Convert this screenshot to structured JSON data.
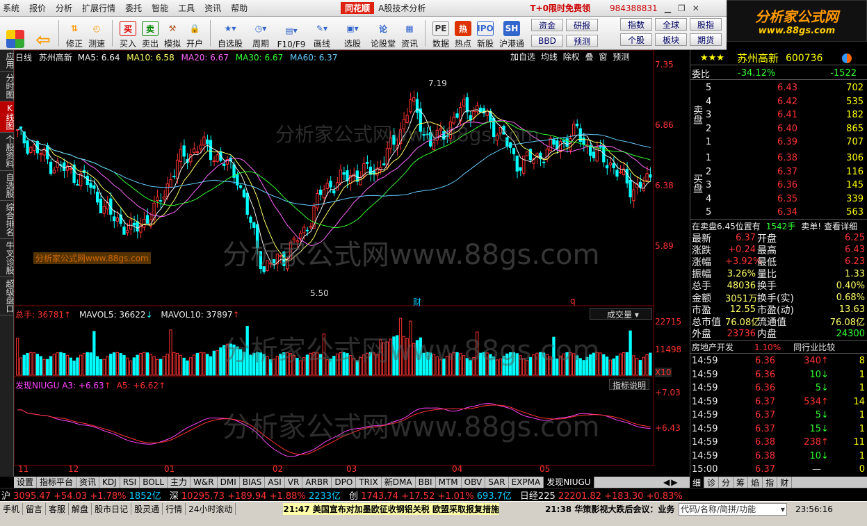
{
  "menu": {
    "items": [
      "系统",
      "报价",
      "分析",
      "扩展行情",
      "委托",
      "智能",
      "工具",
      "资讯",
      "帮助"
    ],
    "brand": "同花顺",
    "title": "A股技术分析",
    "promo": "T+0限时免费领",
    "phone": "984388831"
  },
  "logo": {
    "line1": "分析家公式网",
    "line2": "www.88gs.com"
  },
  "toolbar": {
    "buttons": [
      "修正",
      "测速",
      "买入",
      "卖出",
      "模拟",
      "开户",
      "自选股",
      "周期",
      "F10/F9",
      "画线",
      "选股",
      "论股堂",
      "资讯",
      "数据",
      "热点",
      "新股",
      "沪港通"
    ],
    "text_buttons": [
      "资金",
      "研报",
      "BBD",
      "预测",
      "指数",
      "全球",
      "股指",
      "个股",
      "板块",
      "期货"
    ]
  },
  "sidebar": [
    "应用",
    "分时图",
    "K线图",
    "个股资料",
    "自选股",
    "综合排名",
    "牛叉诊股",
    "超级盘口"
  ],
  "chart": {
    "header": {
      "period": "日线",
      "stock": "苏州高新",
      "ma5": "MA5: 6.64",
      "ma10": "MA10: 6.58",
      "ma20": "MA20: 6.67",
      "ma30": "MA30: 6.67",
      "ma60": "MA60: 6.37"
    },
    "controls": [
      "加自选",
      "均线",
      "除权",
      "叠",
      "窗",
      "预测"
    ],
    "price_axis": [
      "7.35",
      "6.86",
      "6.38",
      "5.89"
    ],
    "high_label": "7.19",
    "low_label": "5.50",
    "markers": [
      "财",
      "q"
    ],
    "watermark": "分析家公式网www.88gs.com",
    "small_watermark": "分析家公式网www.88gs.com",
    "volume": {
      "title": "总手: 36781",
      "mavol5": "MAVOL5: 36622",
      "mavol10": "MAVOL10: 37897",
      "selector": "成交量",
      "axis": [
        "22715",
        "11498"
      ],
      "unit": "X10"
    },
    "indicator": {
      "title": "发现NIUGU",
      "a3": "A3: +6.63",
      "a5": "A5: +6.62",
      "button": "指标说明",
      "axis": [
        "+7.03",
        "+6.43"
      ]
    },
    "months": [
      "11",
      "12",
      "01",
      "02",
      "03",
      "04",
      "05"
    ]
  },
  "chart_data": {
    "type": "line",
    "title": "苏州高新 600736 日线",
    "series": [
      {
        "name": "MA5",
        "last": 6.64
      },
      {
        "name": "MA10",
        "last": 6.58
      },
      {
        "name": "MA20",
        "last": 6.67
      },
      {
        "name": "MA30",
        "last": 6.67
      },
      {
        "name": "MA60",
        "last": 6.37
      }
    ],
    "ylim": [
      5.5,
      7.35
    ],
    "high": 7.19,
    "low": 5.5
  },
  "quote": {
    "stars": "★★★",
    "name": "苏州高新",
    "code": "600736",
    "weibi_label": "委比",
    "weibi": "-34.12%",
    "weicha": "-1522",
    "sell_label": "卖盘",
    "buy_label": "买盘",
    "sells": [
      {
        "lv": "5",
        "p": "6.43",
        "v": "702"
      },
      {
        "lv": "4",
        "p": "6.42",
        "v": "535"
      },
      {
        "lv": "3",
        "p": "6.41",
        "v": "182"
      },
      {
        "lv": "2",
        "p": "6.40",
        "v": "865"
      },
      {
        "lv": "1",
        "p": "6.39",
        "v": "707"
      }
    ],
    "buys": [
      {
        "lv": "1",
        "p": "6.38",
        "v": "306"
      },
      {
        "lv": "2",
        "p": "6.37",
        "v": "116"
      },
      {
        "lv": "3",
        "p": "6.36",
        "v": "145"
      },
      {
        "lv": "4",
        "p": "6.35",
        "v": "339"
      },
      {
        "lv": "5",
        "p": "6.34",
        "v": "563"
      }
    ],
    "notice": "在卖盘6.45位置有",
    "notice_vol": "1542手",
    "notice_tail": "卖单!",
    "detail": "查看详细",
    "stats": [
      {
        "k1": "最新",
        "v1": "6.37",
        "k2": "开盘",
        "v2": "6.25"
      },
      {
        "k1": "涨跌",
        "v1": "+0.24",
        "k2": "最高",
        "v2": "6.43"
      },
      {
        "k1": "涨幅",
        "v1": "+3.92%",
        "k2": "最低",
        "v2": "6.23"
      },
      {
        "k1": "振幅",
        "v1": "3.26%",
        "k2": "量比",
        "v2": "1.33"
      },
      {
        "k1": "总手",
        "v1": "48036",
        "k2": "换手",
        "v2": "0.40%"
      },
      {
        "k1": "金额",
        "v1": "3051万",
        "k2": "换手(实)",
        "v2": "0.68%"
      },
      {
        "k1": "市盈",
        "v1": "12.55",
        "k2": "市盈(动)",
        "v2": "13.63"
      },
      {
        "k1": "总市值",
        "v1": "76.08亿",
        "k2": "流通值",
        "v2": "76.08亿"
      },
      {
        "k1": "外盘",
        "v1": "23736",
        "k2": "内盘",
        "v2": "24300"
      }
    ],
    "sector": "房地产开发",
    "sector_pct": "1.10%",
    "compare": "同行业比较",
    "ticks": [
      {
        "t": "14:59",
        "p": "6.36",
        "v": "340",
        "d": "up",
        "n": "8"
      },
      {
        "t": "14:59",
        "p": "6.36",
        "v": "10",
        "d": "dn",
        "n": "1"
      },
      {
        "t": "14:59",
        "p": "6.36",
        "v": "5",
        "d": "dn",
        "n": "1"
      },
      {
        "t": "14:59",
        "p": "6.37",
        "v": "534",
        "d": "up",
        "n": "14"
      },
      {
        "t": "14:59",
        "p": "6.37",
        "v": "5",
        "d": "dn",
        "n": "1"
      },
      {
        "t": "14:59",
        "p": "6.37",
        "v": "15",
        "d": "dn",
        "n": "1"
      },
      {
        "t": "14:59",
        "p": "6.38",
        "v": "238",
        "d": "up",
        "n": "11"
      },
      {
        "t": "14:59",
        "p": "6.38",
        "v": "10",
        "d": "dn",
        "n": "1"
      },
      {
        "t": "15:00",
        "p": "6.37",
        "v": "—",
        "d": "",
        "n": "0"
      }
    ]
  },
  "bottom_tabs": [
    "设置",
    "指标平台",
    "资讯",
    "KDJ",
    "RSI",
    "BOLL",
    "主力",
    "W&R",
    "DMI",
    "BIAS",
    "ASI",
    "VR",
    "ARBR",
    "DPO",
    "TRIX",
    "新DMA",
    "BBI",
    "MTM",
    "OBV",
    "SAR",
    "EXPMA",
    "发现NIUGU"
  ],
  "right_tabs": [
    "细",
    "诊",
    "分",
    "筹",
    "焰",
    "指",
    "财"
  ],
  "ticker": [
    {
      "label": "沪",
      "v": "3095.47",
      "c": "+54.03",
      "p": "+1.78%",
      "amt": "1852亿"
    },
    {
      "label": "深",
      "v": "10295.73",
      "c": "+189.94",
      "p": "+1.88%",
      "amt": "2233亿"
    },
    {
      "label": "创",
      "v": "1743.74",
      "c": "+17.52",
      "p": "+1.01%",
      "amt": "693.7亿"
    },
    {
      "label": "日经225",
      "v": "22201.82",
      "c": "+183.30",
      "p": "+0.83%",
      "amt": ""
    }
  ],
  "status": {
    "items": [
      "手机",
      "留言",
      "客服",
      "解盘",
      "股市日记",
      "股灵通",
      "行情",
      "24小时滚动"
    ],
    "news1": "21:47 美国宣布对加墨欧征收钢铝关税 欧盟采取报复措施",
    "news2": "21:38 华策影视大跌后会议：业务",
    "search_placeholder": "代码/名称/简拼/功能",
    "clock": "23:56:16"
  }
}
